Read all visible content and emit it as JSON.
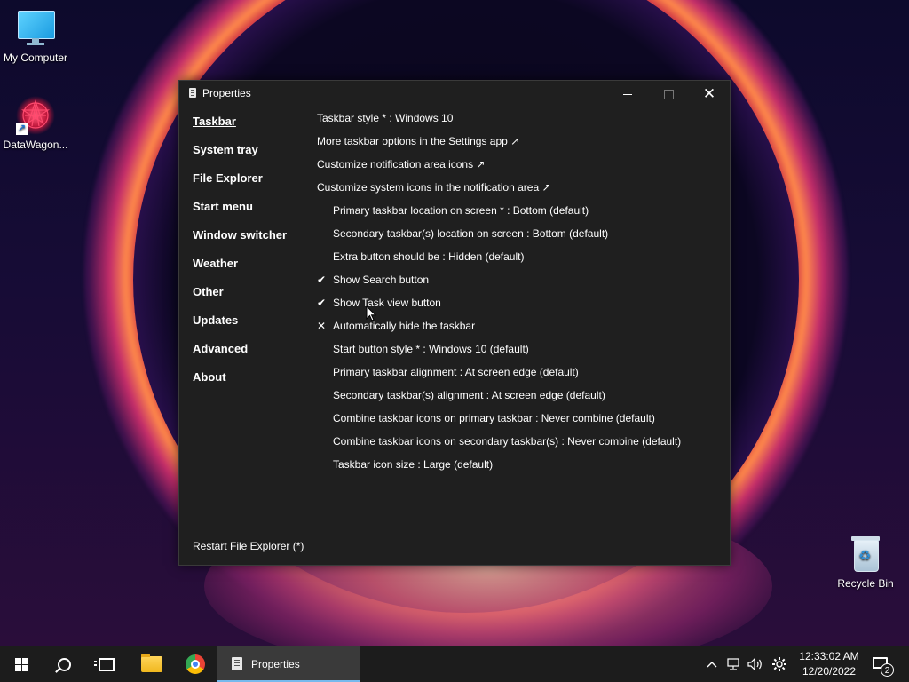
{
  "desktop": {
    "icons": [
      {
        "label": "My Computer",
        "icon": "monitor-icon"
      },
      {
        "label": "DataWagon...",
        "icon": "flower-app-icon"
      },
      {
        "label": "Recycle Bin",
        "icon": "recycle-bin-icon"
      }
    ]
  },
  "window": {
    "title": "Properties",
    "controls": {
      "close_glyph": "✕"
    },
    "nav": [
      {
        "label": "Taskbar",
        "active": true
      },
      {
        "label": "System tray"
      },
      {
        "label": "File Explorer"
      },
      {
        "label": "Start menu"
      },
      {
        "label": "Window switcher"
      },
      {
        "label": "Weather"
      },
      {
        "label": "Other"
      },
      {
        "label": "Updates"
      },
      {
        "label": "Advanced"
      },
      {
        "label": "About"
      }
    ],
    "settings": [
      {
        "text": "Taskbar style * : Windows 10"
      },
      {
        "text": "More taskbar options in the Settings app ↗"
      },
      {
        "text": "Customize notification area icons ↗"
      },
      {
        "text": "Customize system icons in the notification area ↗"
      },
      {
        "text": "Primary taskbar location on screen * : Bottom (default)"
      },
      {
        "text": "Secondary taskbar(s) location on screen : Bottom (default)"
      },
      {
        "text": "Extra button should be : Hidden (default)"
      },
      {
        "text": "Show Search button",
        "mark": "✔"
      },
      {
        "text": "Show Task view button",
        "mark": "✔"
      },
      {
        "text": "Automatically hide the taskbar",
        "mark": "✕"
      },
      {
        "text": "Start button style * : Windows 10 (default)"
      },
      {
        "text": "Primary taskbar alignment : At screen edge (default)"
      },
      {
        "text": "Secondary taskbar(s) alignment : At screen edge (default)"
      },
      {
        "text": "Combine taskbar icons on primary taskbar : Never combine (default)"
      },
      {
        "text": "Combine taskbar icons on secondary taskbar(s) : Never combine (default)"
      },
      {
        "text": "Taskbar icon size : Large (default)"
      }
    ],
    "restart_link": "Restart File Explorer (*)"
  },
  "taskbar": {
    "pinned": [
      "start-icon",
      "search-icon",
      "task-view-icon",
      "file-explorer-icon",
      "chrome-icon"
    ],
    "active_app": {
      "label": "Properties",
      "icon": "properties-app-icon"
    },
    "tray": {
      "chevron": "^",
      "clock_time": "12:33:02 AM",
      "clock_date": "12/20/2022",
      "notification_count": "2"
    }
  },
  "colors": {
    "window_bg": "#1f1f1f",
    "taskbar_bg": "#1c1c1c",
    "active_task_accent": "#76b9ed"
  }
}
